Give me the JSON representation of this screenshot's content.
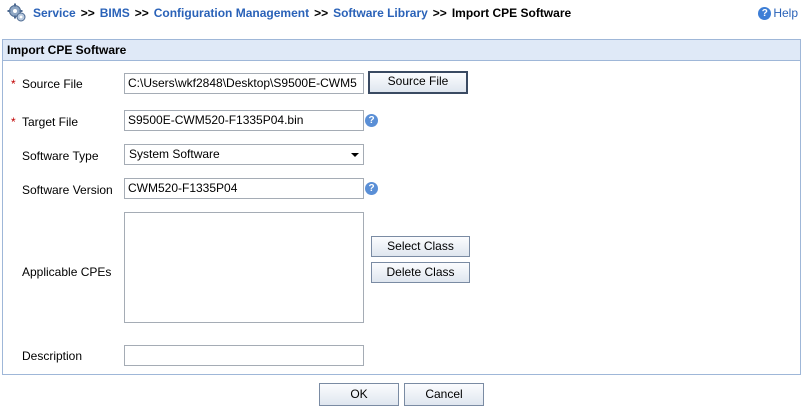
{
  "breadcrumb": {
    "items": [
      "Service",
      "BIMS",
      "Configuration Management",
      "Software Library"
    ],
    "separator": ">>",
    "current": "Import CPE Software"
  },
  "help": {
    "label": "Help",
    "icon": "help-icon"
  },
  "panel": {
    "title": "Import CPE Software",
    "source_file": {
      "label": "Source File",
      "required_mark": "*",
      "value": "C:\\Users\\wkf2848\\Desktop\\S9500E-CWM5",
      "button_label": "Source File"
    },
    "target_file": {
      "label": "Target File",
      "required_mark": "*",
      "value": "S9500E-CWM520-F1335P04.bin",
      "help_icon": "question-icon"
    },
    "software_type": {
      "label": "Software Type",
      "selected": "System Software"
    },
    "software_version": {
      "label": "Software Version",
      "value": "CWM520-F1335P04",
      "help_icon": "question-icon"
    },
    "applicable_cpes": {
      "label": "Applicable CPEs",
      "items": [],
      "select_class_label": "Select Class",
      "delete_class_label": "Delete Class"
    },
    "description": {
      "label": "Description",
      "value": ""
    }
  },
  "footer": {
    "ok_label": "OK",
    "cancel_label": "Cancel"
  },
  "colors": {
    "link": "#2a62b8",
    "panel_header_bg": "#dfe9f7",
    "panel_border": "#9fb7d8",
    "required": "#c00000",
    "help_icon": "#5a8fd6"
  }
}
